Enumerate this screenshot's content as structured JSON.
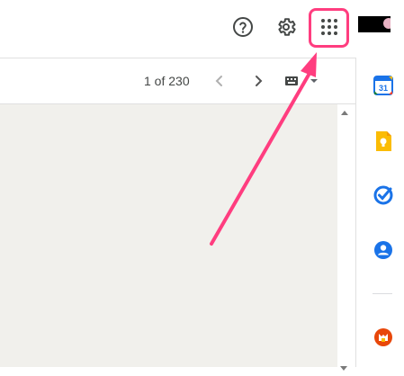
{
  "header": {
    "help_icon": "help-circle-icon",
    "settings_icon": "gear-icon",
    "apps_icon": "apps-grid-icon",
    "highlight_color": "#ff3d7f"
  },
  "toolbar": {
    "pagination": "1 of 230",
    "prev_icon": "chevron-left-icon",
    "next_icon": "chevron-right-icon",
    "input_tools_icon": "keyboard-icon"
  },
  "side_panel": {
    "apps": [
      {
        "name": "calendar",
        "label": "31",
        "color": "#1a73e8"
      },
      {
        "name": "keep",
        "color": "#fbbc04"
      },
      {
        "name": "tasks",
        "color": "#1a73e8"
      },
      {
        "name": "contacts",
        "color": "#1a73e8"
      },
      {
        "name": "addon",
        "color": "#e8470a"
      }
    ]
  },
  "content": {
    "background": "#f1f0ec"
  }
}
